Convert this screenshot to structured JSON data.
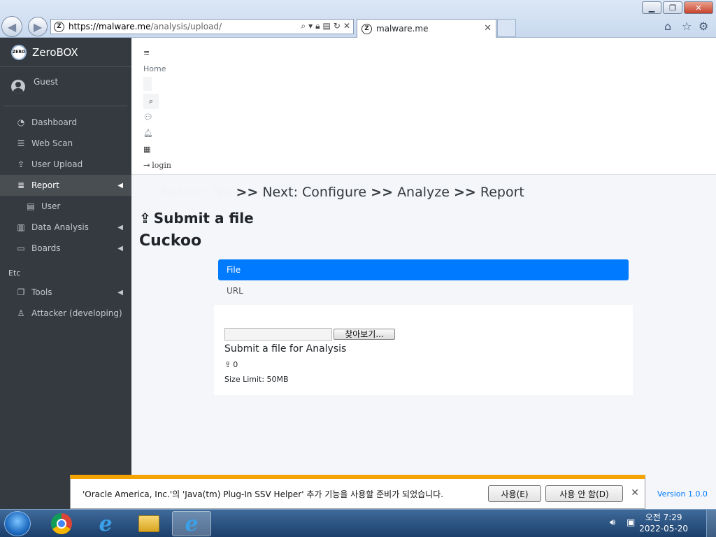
{
  "browser": {
    "url_host": "https://malware.me",
    "url_path": "/analysis/upload/",
    "tab_title": "malware.me",
    "favicon_letter": "Z"
  },
  "sidebar": {
    "brand": "ZeroBOX",
    "logo_text": "ZERO",
    "user": "Guest",
    "items": [
      {
        "label": "Dashboard",
        "icon": "tachometer-icon"
      },
      {
        "label": "Web Scan",
        "icon": "list-icon"
      },
      {
        "label": "User Upload",
        "icon": "upload-icon"
      },
      {
        "label": "Report",
        "icon": "list-alt-icon"
      },
      {
        "label": "User",
        "icon": "file-icon"
      },
      {
        "label": "Data Analysis",
        "icon": "file-chart-icon"
      },
      {
        "label": "Boards",
        "icon": "laptop-icon"
      }
    ],
    "section_header": "Etc",
    "etc_items": [
      {
        "label": "Tools",
        "icon": "copy-icon"
      },
      {
        "label": "Attacker (developing)",
        "icon": "person-icon"
      }
    ]
  },
  "topnav": {
    "home": "Home",
    "login": "login"
  },
  "steps": {
    "current": "Submit file",
    "sep": ">>",
    "next": "Next: Configure",
    "analyze": "Analyze",
    "report": "Report"
  },
  "page": {
    "heading": "Submit a file",
    "subheading": "Cuckoo"
  },
  "pills": {
    "file": "File",
    "url": "URL"
  },
  "form": {
    "browse_label": "찾아보기...",
    "help_text": "Submit a file for Analysis",
    "upload_count": "0",
    "size_limit": "Size Limit: 50MB"
  },
  "notification": {
    "message": "'Oracle America, Inc.'의 'Java(tm) Plug-In SSV Helper' 추가 기능을 사용할 준비가 되었습니다.",
    "enable": "사용(E)",
    "disable": "사용 안 함(D)"
  },
  "footer": {
    "version": "Version 1.0.0"
  },
  "taskbar": {
    "time": "오전 7:29",
    "date": "2022-05-20"
  },
  "colors": {
    "sidebar_bg": "#343a40",
    "primary": "#007bff",
    "notif_accent": "#f5a300"
  }
}
